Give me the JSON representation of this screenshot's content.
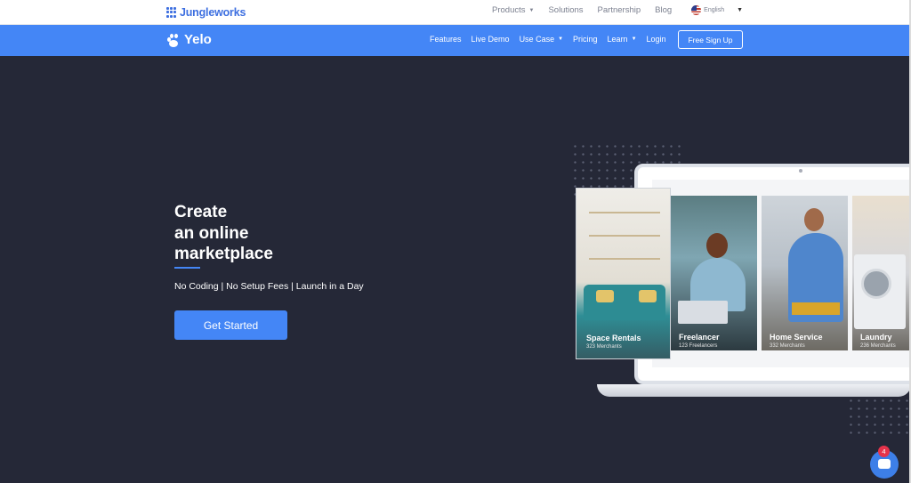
{
  "topbar": {
    "brand": "Jungleworks",
    "links": [
      {
        "label": "Products",
        "dropdown": true
      },
      {
        "label": "Solutions",
        "dropdown": false
      },
      {
        "label": "Partnership",
        "dropdown": false
      },
      {
        "label": "Blog",
        "dropdown": false
      }
    ],
    "language": "English"
  },
  "mainnav": {
    "logo": "Yelo",
    "links": [
      {
        "label": "Features",
        "dropdown": false
      },
      {
        "label": "Live Demo",
        "dropdown": false
      },
      {
        "label": "Use Case",
        "dropdown": true
      },
      {
        "label": "Pricing",
        "dropdown": false
      },
      {
        "label": "Learn",
        "dropdown": true
      },
      {
        "label": "Login",
        "dropdown": false
      }
    ],
    "cta": "Free Sign Up"
  },
  "hero": {
    "title_line1": "Create",
    "title_line2": "an online",
    "title_line3": "marketplace",
    "subtitle": "No Coding | No Setup Fees | Launch in a Day",
    "cta": "Get Started"
  },
  "showcase": {
    "cards": [
      {
        "label": "Space Rentals",
        "count": "323 Merchants"
      },
      {
        "label": "Freelancer",
        "count": "123 Freelancers"
      },
      {
        "label": "Home Service",
        "count": "332 Merchants"
      },
      {
        "label": "Laundry",
        "count": "236 Merchants"
      }
    ]
  },
  "chat": {
    "badge": "4"
  },
  "colors": {
    "primary": "#4486f6",
    "hero_bg": "#252837",
    "brand": "#3d6fe0",
    "badge": "#e5334b"
  }
}
